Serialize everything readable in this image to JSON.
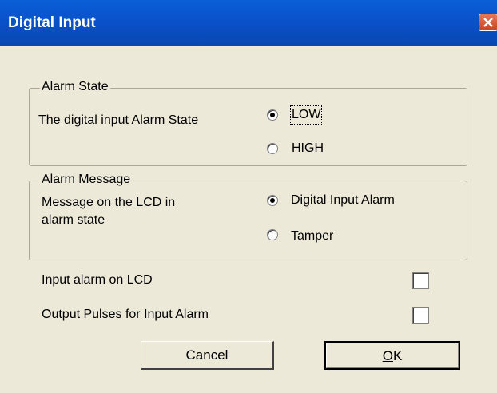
{
  "window": {
    "title": "Digital Input"
  },
  "alarm_state": {
    "legend": "Alarm State",
    "description": "The digital input Alarm State",
    "options": [
      {
        "label": "LOW",
        "selected": true
      },
      {
        "label": "HIGH",
        "selected": false
      }
    ]
  },
  "alarm_message": {
    "legend": "Alarm Message",
    "description_line1": "Message on the LCD in",
    "description_line2": "alarm state",
    "options": [
      {
        "label": "Digital Input Alarm",
        "selected": true
      },
      {
        "label": "Tamper",
        "selected": false
      }
    ]
  },
  "checkboxes": [
    {
      "label": "Input alarm on LCD",
      "checked": false
    },
    {
      "label": "Output Pulses for Input Alarm",
      "checked": false
    }
  ],
  "buttons": {
    "cancel": "Cancel",
    "ok_mnemonic": "O",
    "ok_rest": "K"
  }
}
